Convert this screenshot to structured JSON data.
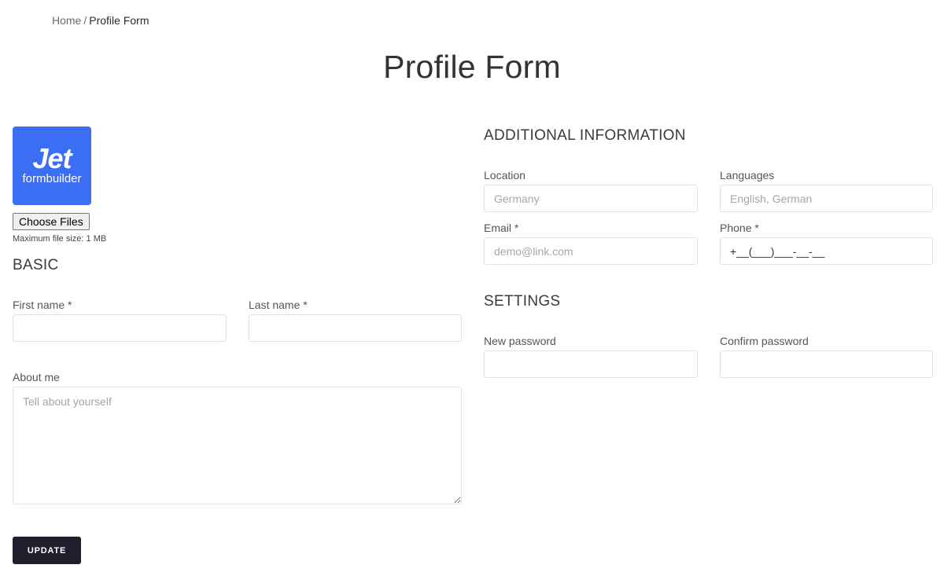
{
  "breadcrumb": {
    "home": "Home",
    "separator": "/",
    "current": "Profile Form"
  },
  "page_title": "Profile Form",
  "logo": {
    "line1": "Jet",
    "line2": "formbuilder",
    "color": "#3b6ef5"
  },
  "upload": {
    "button_label": "Choose Files",
    "note": "Maximum file size: 1 MB"
  },
  "basic": {
    "title": "BASIC",
    "first_name": {
      "label": "First name",
      "required": "*",
      "value": "",
      "placeholder": ""
    },
    "last_name": {
      "label": "Last name",
      "required": "*",
      "value": "",
      "placeholder": ""
    },
    "about": {
      "label": "About me",
      "value": "",
      "placeholder": "Tell about yourself"
    }
  },
  "additional": {
    "title": "ADDITIONAL INFORMATION",
    "location": {
      "label": "Location",
      "value": "",
      "placeholder": "Germany"
    },
    "languages": {
      "label": "Languages",
      "value": "",
      "placeholder": "English, German"
    },
    "email": {
      "label": "Email",
      "required": "*",
      "value": "",
      "placeholder": "demo@link.com"
    },
    "phone": {
      "label": "Phone",
      "required": "*",
      "value": "+__(___)___-__-__",
      "placeholder": ""
    }
  },
  "settings": {
    "title": "SETTINGS",
    "new_password": {
      "label": "New password",
      "value": ""
    },
    "confirm_password": {
      "label": "Confirm password",
      "value": ""
    }
  },
  "submit": {
    "label": "UPDATE",
    "color": "#1f1f2e"
  }
}
